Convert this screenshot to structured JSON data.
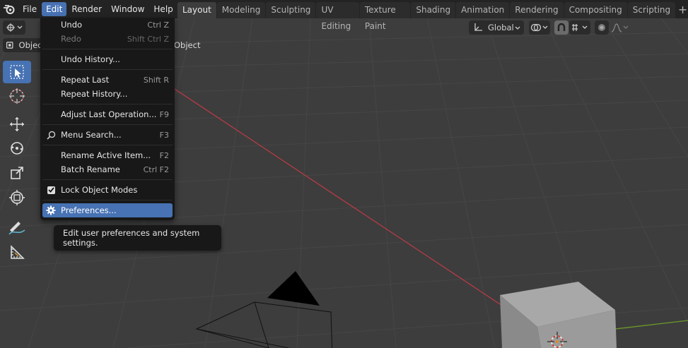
{
  "menubar": {
    "items": [
      {
        "id": "file",
        "label": "File"
      },
      {
        "id": "edit",
        "label": "Edit",
        "active": true
      },
      {
        "id": "render",
        "label": "Render"
      },
      {
        "id": "window",
        "label": "Window"
      },
      {
        "id": "help",
        "label": "Help"
      }
    ]
  },
  "workspaces": {
    "tabs": [
      "Layout",
      "Modeling",
      "Sculpting",
      "UV Editing",
      "Texture Paint",
      "Shading",
      "Animation",
      "Rendering",
      "Compositing",
      "Scripting"
    ],
    "active": "Layout"
  },
  "viewport_header": {
    "transform_orientation": "Global",
    "mode_label": "Object",
    "object_menu": "Object"
  },
  "edit_menu": {
    "items": [
      {
        "label": "Undo",
        "shortcut": "Ctrl Z",
        "disabled": false
      },
      {
        "label": "Redo",
        "shortcut": "Shift Ctrl Z",
        "disabled": true
      },
      {
        "label": "Undo History...",
        "shortcut": "",
        "disabled": false
      },
      {
        "label": "Repeat Last",
        "shortcut": "Shift R",
        "disabled": false
      },
      {
        "label": "Repeat History...",
        "shortcut": "",
        "disabled": false
      },
      {
        "label": "Adjust Last Operation...",
        "shortcut": "F9",
        "disabled": false
      },
      {
        "label": "Menu Search...",
        "shortcut": "F3",
        "disabled": false,
        "icon": "search-icon"
      },
      {
        "label": "Rename Active Item...",
        "shortcut": "F2",
        "disabled": false
      },
      {
        "label": "Batch Rename",
        "shortcut": "Ctrl F2",
        "disabled": false
      },
      {
        "label": "Lock Object Modes",
        "shortcut": "",
        "checked": true
      },
      {
        "label": "Preferences...",
        "shortcut": "",
        "highlighted": true,
        "icon": "gear-icon"
      }
    ]
  },
  "tooltip": {
    "text": "Edit user preferences and system settings."
  },
  "colors": {
    "accent": "#4772b3",
    "menu_bg": "#181818",
    "topbar_bg": "#232323",
    "viewport_bg": "#3d3d3d",
    "x_axis": "#b63b45",
    "y_axis": "#6a9a28"
  }
}
